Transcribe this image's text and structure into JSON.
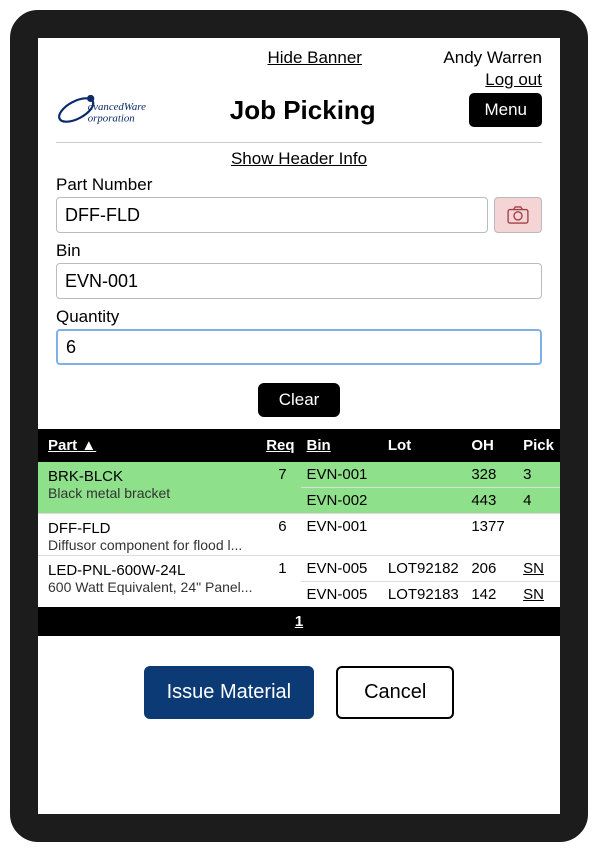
{
  "header": {
    "hide_banner": "Hide Banner",
    "user_name": "Andy Warren",
    "logout": "Log out",
    "title": "Job Picking",
    "menu": "Menu",
    "show_header": "Show Header Info"
  },
  "fields": {
    "part_label": "Part Number",
    "part_value": "DFF-FLD",
    "camera_icon": "camera-icon",
    "bin_label": "Bin",
    "bin_value": "EVN-001",
    "qty_label": "Quantity",
    "qty_value": "6"
  },
  "buttons": {
    "clear": "Clear",
    "issue": "Issue Material",
    "cancel": "Cancel"
  },
  "table": {
    "headers": {
      "part": "Part ▲",
      "req": "Req",
      "bin": "Bin",
      "lot": "Lot",
      "oh": "OH",
      "pick": "Pick"
    },
    "rows": [
      {
        "part": "BRK-BLCK",
        "desc": "Black metal bracket",
        "req": "7",
        "highlight": true,
        "bins": [
          {
            "bin": "EVN-001",
            "lot": "",
            "oh": "328",
            "pick": "3",
            "pick_link": false
          },
          {
            "bin": "EVN-002",
            "lot": "",
            "oh": "443",
            "pick": "4",
            "pick_link": false
          }
        ]
      },
      {
        "part": "DFF-FLD",
        "desc": "Diffusor component for flood l...",
        "req": "6",
        "highlight": false,
        "bins": [
          {
            "bin": "EVN-001",
            "lot": "",
            "oh": "1377",
            "pick": "",
            "pick_link": false
          }
        ]
      },
      {
        "part": "LED-PNL-600W-24L",
        "desc": "600 Watt Equivalent, 24\" Panel...",
        "req": "1",
        "highlight": false,
        "bins": [
          {
            "bin": "EVN-005",
            "lot": "LOT92182",
            "oh": "206",
            "pick": "SN",
            "pick_link": true
          },
          {
            "bin": "EVN-005",
            "lot": "LOT92183",
            "oh": "142",
            "pick": "SN",
            "pick_link": true
          }
        ]
      }
    ],
    "page": "1"
  },
  "logo": {
    "line1": "dvancedWare",
    "line2": "orporation"
  }
}
